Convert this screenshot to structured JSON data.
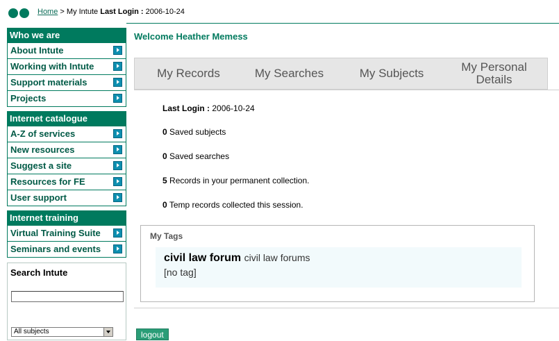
{
  "breadcrumb": {
    "home": "Home",
    "separator": ">",
    "current": "My Intute",
    "last_login_label": "Last Login :",
    "last_login_value": "2006-10-24"
  },
  "nav": {
    "groups": [
      {
        "heading": "Who we are",
        "items": [
          "About Intute",
          "Working with Intute",
          "Support materials",
          "Projects"
        ]
      },
      {
        "heading": "Internet catalogue",
        "items": [
          "A-Z of services",
          "New resources",
          "Suggest a site",
          "Resources for FE",
          "User support"
        ]
      },
      {
        "heading": "Internet training",
        "items": [
          "Virtual Training Suite",
          "Seminars and events"
        ]
      }
    ]
  },
  "search": {
    "title": "Search Intute",
    "input_value": "",
    "select_value": "All subjects"
  },
  "main": {
    "welcome": "Welcome Heather Memess",
    "tabs": [
      "My Records",
      "My Searches",
      "My Subjects",
      "My Personal Details"
    ],
    "last_login_label": "Last Login :",
    "last_login_value": "2006-10-24",
    "stats": [
      {
        "count": "0",
        "label": "Saved subjects"
      },
      {
        "count": "0",
        "label": "Saved searches"
      },
      {
        "count": "5",
        "label": "Records in your permanent collection."
      },
      {
        "count": "0",
        "label": "Temp records collected this session."
      }
    ],
    "tags": {
      "title": "My Tags",
      "tag_name": "civil law forum",
      "tag_desc": "civil law forums",
      "no_tag": "[no tag]"
    },
    "logout": "logout"
  },
  "colors": {
    "brand_green": "#007a5e",
    "arrow_blue": "#0e8fb0",
    "tab_bg": "#e6e6e6"
  }
}
